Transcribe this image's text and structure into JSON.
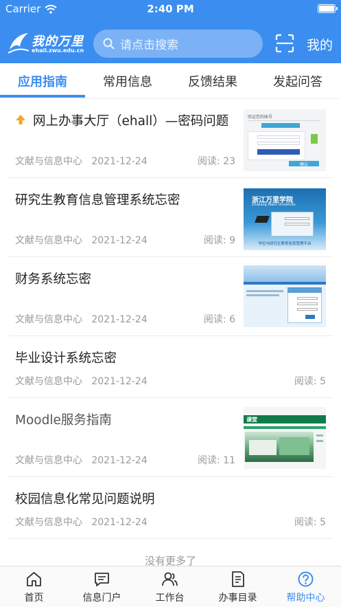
{
  "status_bar": {
    "carrier": "Carrier",
    "time": "2:40 PM"
  },
  "header": {
    "logo_name": "我的万里",
    "logo_sub": "ehall.zwu.edu.cn",
    "search_placeholder": "请点击搜索",
    "me_label": "我的",
    "accent_color": "#3b8ef0"
  },
  "tabs": [
    {
      "label": "应用指南",
      "active": true
    },
    {
      "label": "常用信息",
      "active": false
    },
    {
      "label": "反馈结果",
      "active": false
    },
    {
      "label": "发起问答",
      "active": false
    }
  ],
  "articles": [
    {
      "title": "网上办事大厅（ehall）—密码问题",
      "source": "文献与信息中心",
      "date": "2021-12-24",
      "reads": "阅读: 23",
      "pinned": true,
      "thumb": {
        "heading": "验证您的账号",
        "button": "确认"
      }
    },
    {
      "title": "研究生教育信息管理系统忘密",
      "source": "文献与信息中心",
      "date": "2021-12-24",
      "reads": "阅读: 9",
      "thumb": {
        "school": "浙江万里学院",
        "school_en": "Zhejiang Wanli University",
        "caption": "学位与研究生教育信息管理平台"
      }
    },
    {
      "title": "财务系统忘密",
      "source": "文献与信息中心",
      "date": "2021-12-24",
      "reads": "阅读: 6"
    },
    {
      "title": "毕业设计系统忘密",
      "source": "文献与信息中心",
      "date": "2021-12-24",
      "reads": "阅读: 5"
    },
    {
      "title": "Moodle服务指南",
      "source": "文献与信息中心",
      "date": "2021-12-24",
      "reads": "阅读: 11",
      "thumb": {
        "heading": "课堂"
      }
    },
    {
      "title": "校园信息化常见问题说明",
      "source": "文献与信息中心",
      "date": "2021-12-24",
      "reads": "阅读: 5"
    }
  ],
  "no_more": "没有更多了",
  "bottom_nav": [
    {
      "label": "首页",
      "icon": "home-icon"
    },
    {
      "label": "信息门户",
      "icon": "message-icon"
    },
    {
      "label": "工作台",
      "icon": "people-icon"
    },
    {
      "label": "办事目录",
      "icon": "document-icon"
    },
    {
      "label": "帮助中心",
      "icon": "help-icon",
      "active": true
    }
  ]
}
